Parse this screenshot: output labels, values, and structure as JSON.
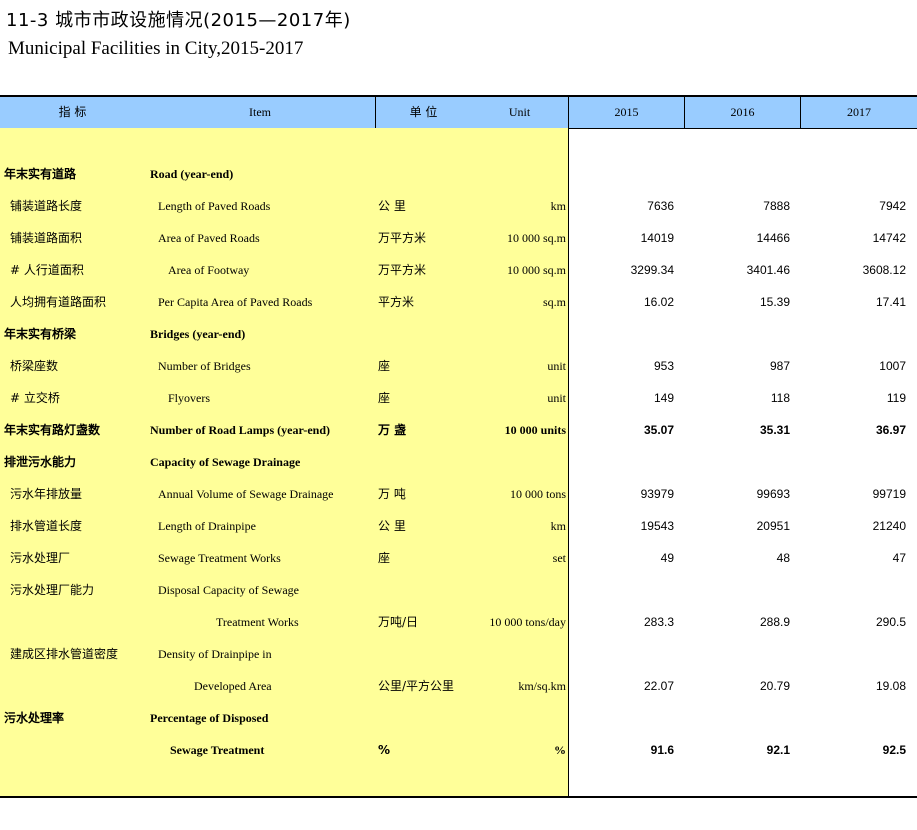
{
  "title_cn": "11-3   城市市政设施情况(2015—2017年)",
  "title_en": "Municipal Facilities in City,2015-2017",
  "header": {
    "indicator_cn": "指   标",
    "item": "Item",
    "unit_cn": "单 位",
    "unit_en": "Unit",
    "years": [
      "2015",
      "2016",
      "2017"
    ]
  },
  "rows": [
    {
      "cn": "年末实有道路",
      "en": "Road (year-end)",
      "unit_cn": "",
      "unit_en": "",
      "v": [
        "",
        "",
        ""
      ],
      "bold": true,
      "cn_indent": 0,
      "en_indent": 0
    },
    {
      "cn": "铺装道路长度",
      "en": "Length of Paved Roads",
      "unit_cn": "公  里",
      "unit_en": "km",
      "v": [
        "7636",
        "7888",
        "7942"
      ],
      "bold": false,
      "cn_indent": 6,
      "en_indent": 8
    },
    {
      "cn": "铺装道路面积",
      "en": "Area of Paved Roads",
      "unit_cn": "万平方米",
      "unit_en": "10 000 sq.m",
      "v": [
        "14019",
        "14466",
        "14742"
      ],
      "bold": false,
      "cn_indent": 6,
      "en_indent": 8
    },
    {
      "cn": "# 人行道面积",
      "en": "Area of Footway",
      "unit_cn": "万平方米",
      "unit_en": "10 000 sq.m",
      "v": [
        "3299.34",
        "3401.46",
        "3608.12"
      ],
      "bold": false,
      "cn_indent": 6,
      "en_indent": 18
    },
    {
      "cn": "人均拥有道路面积",
      "en": "Per Capita Area of Paved Roads",
      "unit_cn": "平方米",
      "unit_en": "sq.m",
      "v": [
        "16.02",
        "15.39",
        "17.41"
      ],
      "bold": false,
      "cn_indent": 6,
      "en_indent": 8
    },
    {
      "cn": "年末实有桥梁",
      "en": "Bridges (year-end)",
      "unit_cn": "",
      "unit_en": "",
      "v": [
        "",
        "",
        ""
      ],
      "bold": true,
      "cn_indent": 0,
      "en_indent": 0
    },
    {
      "cn": "桥梁座数",
      "en": "Number of Bridges",
      "unit_cn": "座",
      "unit_en": "unit",
      "v": [
        "953",
        "987",
        "1007"
      ],
      "bold": false,
      "cn_indent": 6,
      "en_indent": 8
    },
    {
      "cn": "# 立交桥",
      "en": "Flyovers",
      "unit_cn": "座",
      "unit_en": "unit",
      "v": [
        "149",
        "118",
        "119"
      ],
      "bold": false,
      "cn_indent": 6,
      "en_indent": 18
    },
    {
      "cn": "年末实有路灯盏数",
      "en": "Number of Road Lamps (year-end)",
      "unit_cn": "万  盏",
      "unit_en": "10 000 units",
      "v": [
        "35.07",
        "35.31",
        "36.97"
      ],
      "bold": true,
      "cn_indent": 0,
      "en_indent": 0
    },
    {
      "cn": "排泄污水能力",
      "en": "Capacity of Sewage Drainage",
      "unit_cn": "",
      "unit_en": "",
      "v": [
        "",
        "",
        ""
      ],
      "bold": true,
      "cn_indent": 0,
      "en_indent": 0
    },
    {
      "cn": "污水年排放量",
      "en": "Annual Volume of Sewage Drainage",
      "unit_cn": "万  吨",
      "unit_en": "10 000 tons",
      "v": [
        "93979",
        "99693",
        "99719"
      ],
      "bold": false,
      "cn_indent": 6,
      "en_indent": 8
    },
    {
      "cn": "排水管道长度",
      "en": "Length of Drainpipe",
      "unit_cn": "公  里",
      "unit_en": "km",
      "v": [
        "19543",
        "20951",
        "21240"
      ],
      "bold": false,
      "cn_indent": 6,
      "en_indent": 8
    },
    {
      "cn": "污水处理厂",
      "en": "Sewage Treatment Works",
      "unit_cn": "座",
      "unit_en": "set",
      "v": [
        "49",
        "48",
        "47"
      ],
      "bold": false,
      "cn_indent": 6,
      "en_indent": 8
    },
    {
      "cn": "污水处理厂能力",
      "en": "Disposal Capacity of Sewage",
      "unit_cn": "",
      "unit_en": "",
      "v": [
        "",
        "",
        ""
      ],
      "bold": false,
      "cn_indent": 6,
      "en_indent": 8
    },
    {
      "cn": "",
      "en": "Treatment Works",
      "unit_cn": "万吨/日",
      "unit_en": "10 000 tons/day",
      "v": [
        "283.3",
        "288.9",
        "290.5"
      ],
      "bold": false,
      "cn_indent": 6,
      "en_indent": 66
    },
    {
      "cn": "建成区排水管道密度",
      "en": "Density of Drainpipe in",
      "unit_cn": "",
      "unit_en": "",
      "v": [
        "",
        "",
        ""
      ],
      "bold": false,
      "cn_indent": 6,
      "en_indent": 8
    },
    {
      "cn": "",
      "en": "Developed Area",
      "unit_cn": "公里/平方公里",
      "unit_en": "km/sq.km",
      "v": [
        "22.07",
        "20.79",
        "19.08"
      ],
      "bold": false,
      "cn_indent": 6,
      "en_indent": 44
    },
    {
      "cn": "污水处理率",
      "en": "Percentage of Disposed",
      "unit_cn": "",
      "unit_en": "",
      "v": [
        "",
        "",
        ""
      ],
      "bold": true,
      "cn_indent": 0,
      "en_indent": 0
    },
    {
      "cn": "",
      "en": "Sewage Treatment",
      "unit_cn": "%",
      "unit_en": "%",
      "v": [
        "91.6",
        "92.1",
        "92.5"
      ],
      "bold": true,
      "cn_indent": 0,
      "en_indent": 20
    }
  ]
}
